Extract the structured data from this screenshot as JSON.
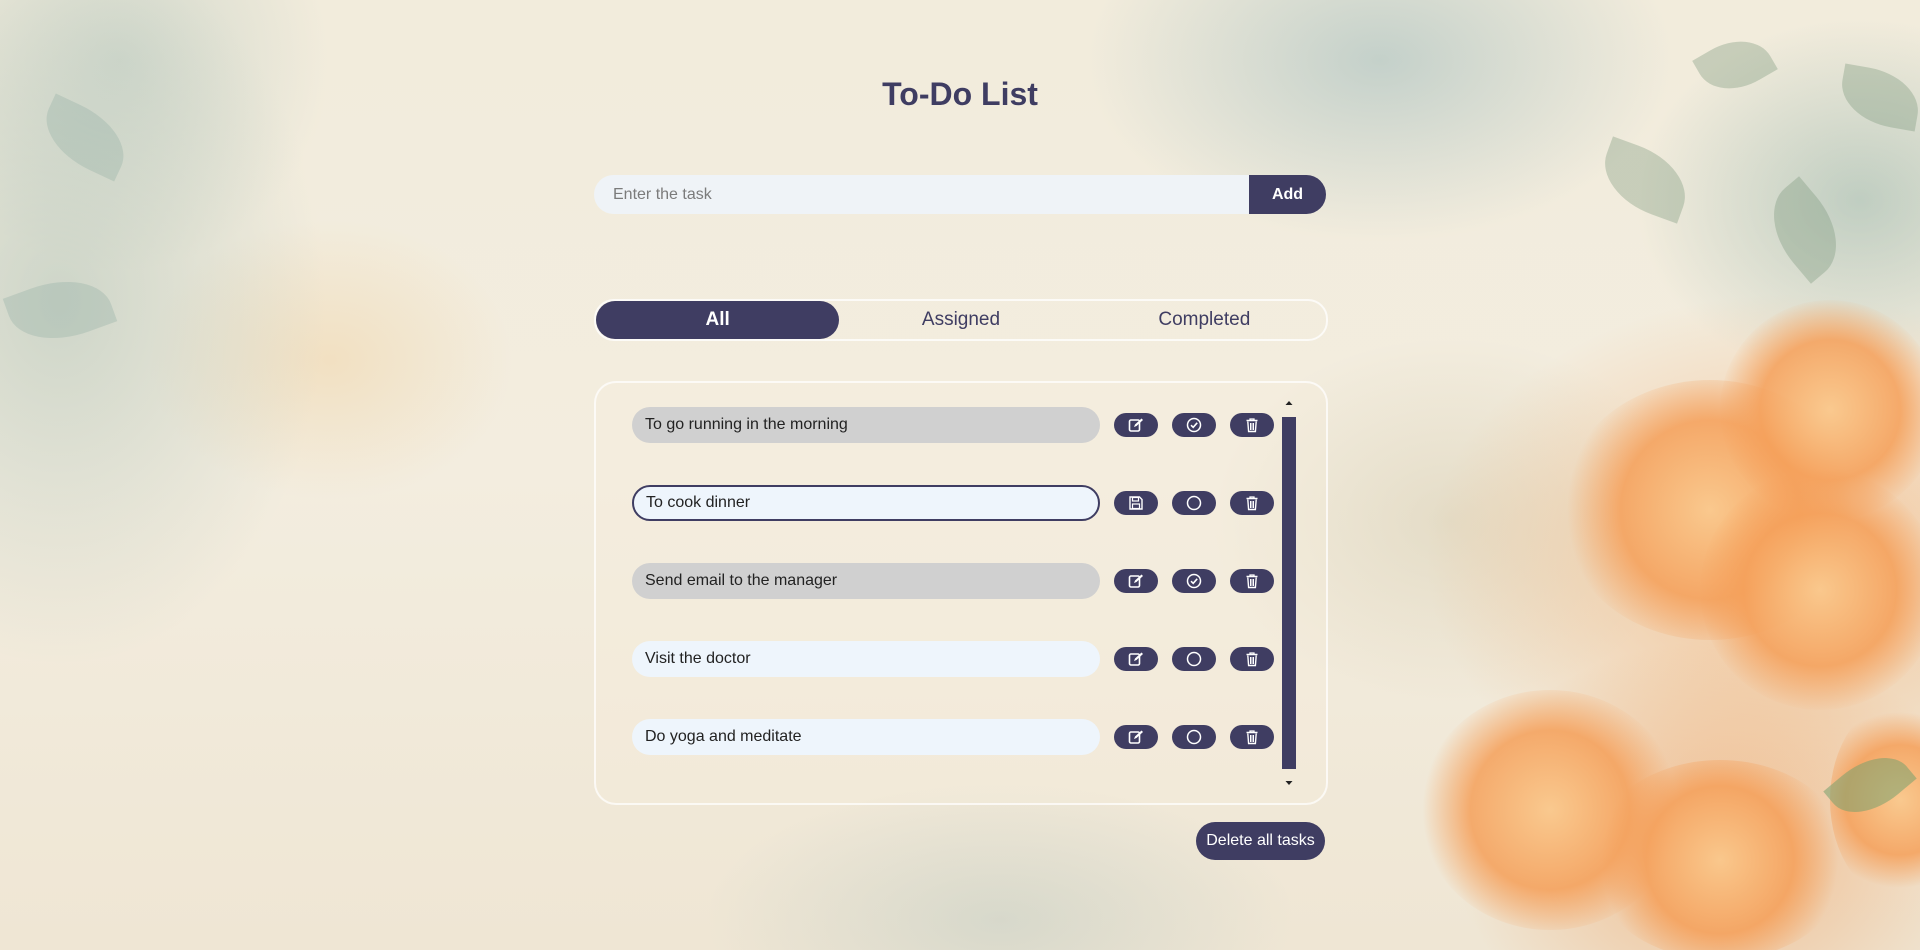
{
  "app": {
    "title": "To-Do List"
  },
  "add_form": {
    "placeholder": "Enter the task",
    "value": "",
    "add_label": "Add"
  },
  "tabs": [
    {
      "label": "All",
      "active": true
    },
    {
      "label": "Assigned",
      "active": false
    },
    {
      "label": "Completed",
      "active": false
    }
  ],
  "tasks": [
    {
      "text": "To go running in the morning",
      "state": "completed",
      "primary_icon": "edit-icon",
      "status_icon": "check-circle-icon",
      "delete_icon": "trash-icon"
    },
    {
      "text": "To cook dinner",
      "state": "editing",
      "primary_icon": "save-icon",
      "status_icon": "circle-icon",
      "delete_icon": "trash-icon"
    },
    {
      "text": "Send email to the manager",
      "state": "completed",
      "primary_icon": "edit-icon",
      "status_icon": "check-circle-icon",
      "delete_icon": "trash-icon"
    },
    {
      "text": "Visit the doctor",
      "state": "assigned",
      "primary_icon": "edit-icon",
      "status_icon": "circle-icon",
      "delete_icon": "trash-icon"
    },
    {
      "text": "Do yoga and meditate",
      "state": "assigned",
      "primary_icon": "edit-icon",
      "status_icon": "circle-icon",
      "delete_icon": "trash-icon"
    }
  ],
  "footer": {
    "delete_all_label": "Delete all tasks"
  },
  "colors": {
    "accent": "#3f3d62",
    "input_bg": "#eef5fc",
    "completed_bg": "#d0d0d0"
  }
}
